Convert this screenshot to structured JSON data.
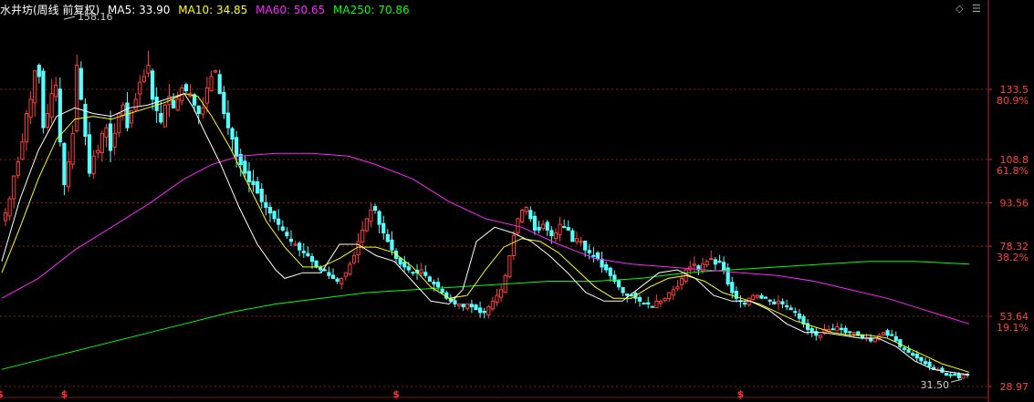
{
  "header": {
    "title": "水井坊(周线 前复权)",
    "ma5_label": "MA5: 33.90",
    "ma10_label": "MA10: 34.85",
    "ma60_label": "MA60: 50.65",
    "ma250_label": "MA250: 70.86"
  },
  "colors": {
    "up": "#ff3c3c",
    "down": "#54ffff",
    "ma5": "#ffffff",
    "ma10": "#ffff00",
    "ma60": "#ff22ff",
    "ma250": "#00ff00",
    "grid": "#8b1a1a",
    "axis_text": "#ff4040",
    "annotation": "#cccccc"
  },
  "controls": {
    "diamond_icon": "◇",
    "menu_icon": "☰"
  },
  "chart_data": {
    "type": "candlestick",
    "title": "水井坊(周线 前复权)",
    "ylim": [
      26.5,
      165
    ],
    "grid": true,
    "price_levels": [
      {
        "price": 133.5,
        "label": "133.5",
        "pct": "80.9%"
      },
      {
        "price": 108.8,
        "label": "108.8",
        "pct": "61.8%"
      },
      {
        "price": 93.56,
        "label": "93.56",
        "pct": ""
      },
      {
        "price": 78.32,
        "label": "78.32",
        "pct": "38.2%"
      },
      {
        "price": 53.64,
        "label": "53.64",
        "pct": "19.1%"
      },
      {
        "price": 28.97,
        "label": "28.97",
        "pct": ""
      }
    ],
    "high_annotation": {
      "label": "158.16",
      "value": 158.16
    },
    "low_annotation": {
      "label": "31.50",
      "value": 31.5
    },
    "markers": [
      "$",
      "$",
      "$",
      "$"
    ],
    "marker_candle_index": [
      14,
      93,
      175,
      253
    ],
    "closes": [
      90,
      95,
      103,
      108,
      115,
      125,
      130,
      140,
      138,
      120,
      125,
      132,
      135,
      115,
      100,
      108,
      118,
      142,
      130,
      117,
      104,
      110,
      112,
      118,
      120,
      112,
      118,
      125,
      128,
      120,
      126,
      130,
      136,
      138,
      142,
      130,
      126,
      122,
      128,
      131,
      127,
      130,
      134,
      133,
      132,
      128,
      125,
      127,
      134,
      138,
      140,
      132,
      125,
      120,
      116,
      110,
      107,
      104,
      101,
      100,
      97,
      94,
      92,
      90,
      88,
      86,
      84,
      82,
      80,
      79,
      77,
      76,
      75,
      73,
      71,
      70,
      70,
      68,
      67,
      66,
      67,
      69,
      72,
      75,
      80,
      84,
      88,
      91,
      91,
      86,
      83,
      80,
      77,
      74,
      72,
      71,
      70,
      69,
      69,
      70,
      68,
      66,
      65,
      64,
      62,
      60,
      59,
      58,
      58,
      57,
      58,
      57,
      56,
      55,
      55,
      57,
      59,
      61,
      63,
      68,
      75,
      82,
      88,
      91,
      92,
      88,
      84,
      84,
      86,
      84,
      82,
      83,
      86,
      85,
      84,
      80,
      81,
      80,
      77,
      76,
      75,
      74,
      71,
      70,
      68,
      66,
      64,
      62,
      61,
      61,
      60,
      59,
      58,
      58,
      57,
      59,
      59,
      60,
      62,
      63,
      64,
      67,
      70,
      71,
      72,
      70,
      72,
      73,
      74,
      72,
      73,
      70,
      65,
      62,
      60,
      59,
      58,
      60,
      61,
      61,
      60,
      60,
      59,
      58,
      59,
      58,
      57,
      56,
      55,
      53,
      51,
      49,
      48,
      47,
      47,
      49,
      49,
      49,
      50,
      49,
      48,
      48,
      48,
      47,
      46,
      46,
      45,
      46,
      47,
      48,
      47,
      47,
      45,
      43,
      42,
      41,
      40,
      39,
      38,
      37,
      36,
      35,
      35,
      34,
      33,
      33,
      33,
      32,
      33,
      33
    ],
    "ma5": [
      [
        0,
        73
      ],
      [
        20,
        95
      ],
      [
        40,
        112
      ],
      [
        60,
        124
      ],
      [
        80,
        127
      ],
      [
        100,
        125
      ],
      [
        120,
        124
      ],
      [
        140,
        127
      ],
      [
        160,
        128
      ],
      [
        180,
        130
      ],
      [
        200,
        132
      ],
      [
        210,
        127
      ],
      [
        220,
        120
      ],
      [
        240,
        107
      ],
      [
        260,
        92
      ],
      [
        280,
        79
      ],
      [
        300,
        70
      ],
      [
        310,
        67
      ],
      [
        330,
        69
      ],
      [
        350,
        69
      ],
      [
        370,
        79
      ],
      [
        390,
        79
      ],
      [
        410,
        75
      ],
      [
        430,
        73
      ],
      [
        450,
        66
      ],
      [
        470,
        59
      ],
      [
        490,
        58
      ],
      [
        505,
        63
      ],
      [
        520,
        80
      ],
      [
        540,
        85
      ],
      [
        560,
        83
      ],
      [
        580,
        80
      ],
      [
        600,
        75
      ],
      [
        620,
        69
      ],
      [
        640,
        62
      ],
      [
        660,
        59
      ],
      [
        680,
        59
      ],
      [
        700,
        64
      ],
      [
        720,
        69
      ],
      [
        740,
        70
      ],
      [
        760,
        67
      ],
      [
        780,
        61
      ],
      [
        800,
        59
      ],
      [
        820,
        59
      ],
      [
        840,
        56
      ],
      [
        860,
        51
      ],
      [
        880,
        48
      ],
      [
        900,
        48
      ],
      [
        920,
        47
      ],
      [
        940,
        46
      ],
      [
        960,
        46
      ],
      [
        980,
        43
      ],
      [
        1000,
        38
      ],
      [
        1020,
        35
      ],
      [
        1040,
        34
      ],
      [
        1060,
        33
      ]
    ],
    "ma10": [
      [
        0,
        69
      ],
      [
        20,
        85
      ],
      [
        40,
        102
      ],
      [
        60,
        116
      ],
      [
        80,
        123
      ],
      [
        100,
        124
      ],
      [
        120,
        123
      ],
      [
        140,
        125
      ],
      [
        160,
        127
      ],
      [
        180,
        129
      ],
      [
        200,
        132
      ],
      [
        215,
        131
      ],
      [
        230,
        124
      ],
      [
        250,
        113
      ],
      [
        270,
        100
      ],
      [
        290,
        87
      ],
      [
        310,
        78
      ],
      [
        330,
        71
      ],
      [
        350,
        71
      ],
      [
        370,
        74
      ],
      [
        390,
        78
      ],
      [
        410,
        78
      ],
      [
        430,
        76
      ],
      [
        450,
        71
      ],
      [
        470,
        64
      ],
      [
        490,
        60
      ],
      [
        510,
        61
      ],
      [
        530,
        70
      ],
      [
        550,
        78
      ],
      [
        570,
        81
      ],
      [
        590,
        80
      ],
      [
        610,
        76
      ],
      [
        630,
        70
      ],
      [
        650,
        64
      ],
      [
        670,
        60
      ],
      [
        690,
        60
      ],
      [
        710,
        64
      ],
      [
        730,
        67
      ],
      [
        750,
        68
      ],
      [
        770,
        66
      ],
      [
        790,
        62
      ],
      [
        810,
        60
      ],
      [
        830,
        58
      ],
      [
        850,
        55
      ],
      [
        870,
        52
      ],
      [
        890,
        50
      ],
      [
        910,
        48
      ],
      [
        930,
        47
      ],
      [
        950,
        47
      ],
      [
        970,
        46
      ],
      [
        990,
        43
      ],
      [
        1010,
        40
      ],
      [
        1030,
        37
      ],
      [
        1060,
        34
      ]
    ],
    "ma60": [
      [
        0,
        60
      ],
      [
        40,
        67
      ],
      [
        80,
        77
      ],
      [
        120,
        85
      ],
      [
        160,
        93
      ],
      [
        200,
        102
      ],
      [
        230,
        107
      ],
      [
        260,
        110
      ],
      [
        300,
        111
      ],
      [
        340,
        111
      ],
      [
        380,
        110
      ],
      [
        410,
        107
      ],
      [
        450,
        102
      ],
      [
        490,
        94
      ],
      [
        530,
        88
      ],
      [
        570,
        85
      ],
      [
        610,
        79
      ],
      [
        650,
        74
      ],
      [
        690,
        72
      ],
      [
        730,
        71
      ],
      [
        770,
        70
      ],
      [
        810,
        69
      ],
      [
        850,
        68
      ],
      [
        890,
        66
      ],
      [
        930,
        63
      ],
      [
        970,
        60
      ],
      [
        1010,
        56
      ],
      [
        1060,
        51
      ]
    ],
    "ma250": [
      [
        0,
        35
      ],
      [
        50,
        39
      ],
      [
        100,
        43
      ],
      [
        150,
        47
      ],
      [
        200,
        51
      ],
      [
        250,
        55
      ],
      [
        300,
        58
      ],
      [
        350,
        60
      ],
      [
        400,
        62
      ],
      [
        450,
        63
      ],
      [
        500,
        64
      ],
      [
        550,
        65
      ],
      [
        600,
        66
      ],
      [
        650,
        66
      ],
      [
        700,
        67
      ],
      [
        750,
        69
      ],
      [
        800,
        70
      ],
      [
        850,
        71
      ],
      [
        900,
        72
      ],
      [
        950,
        73
      ],
      [
        1000,
        73
      ],
      [
        1060,
        72
      ]
    ]
  }
}
